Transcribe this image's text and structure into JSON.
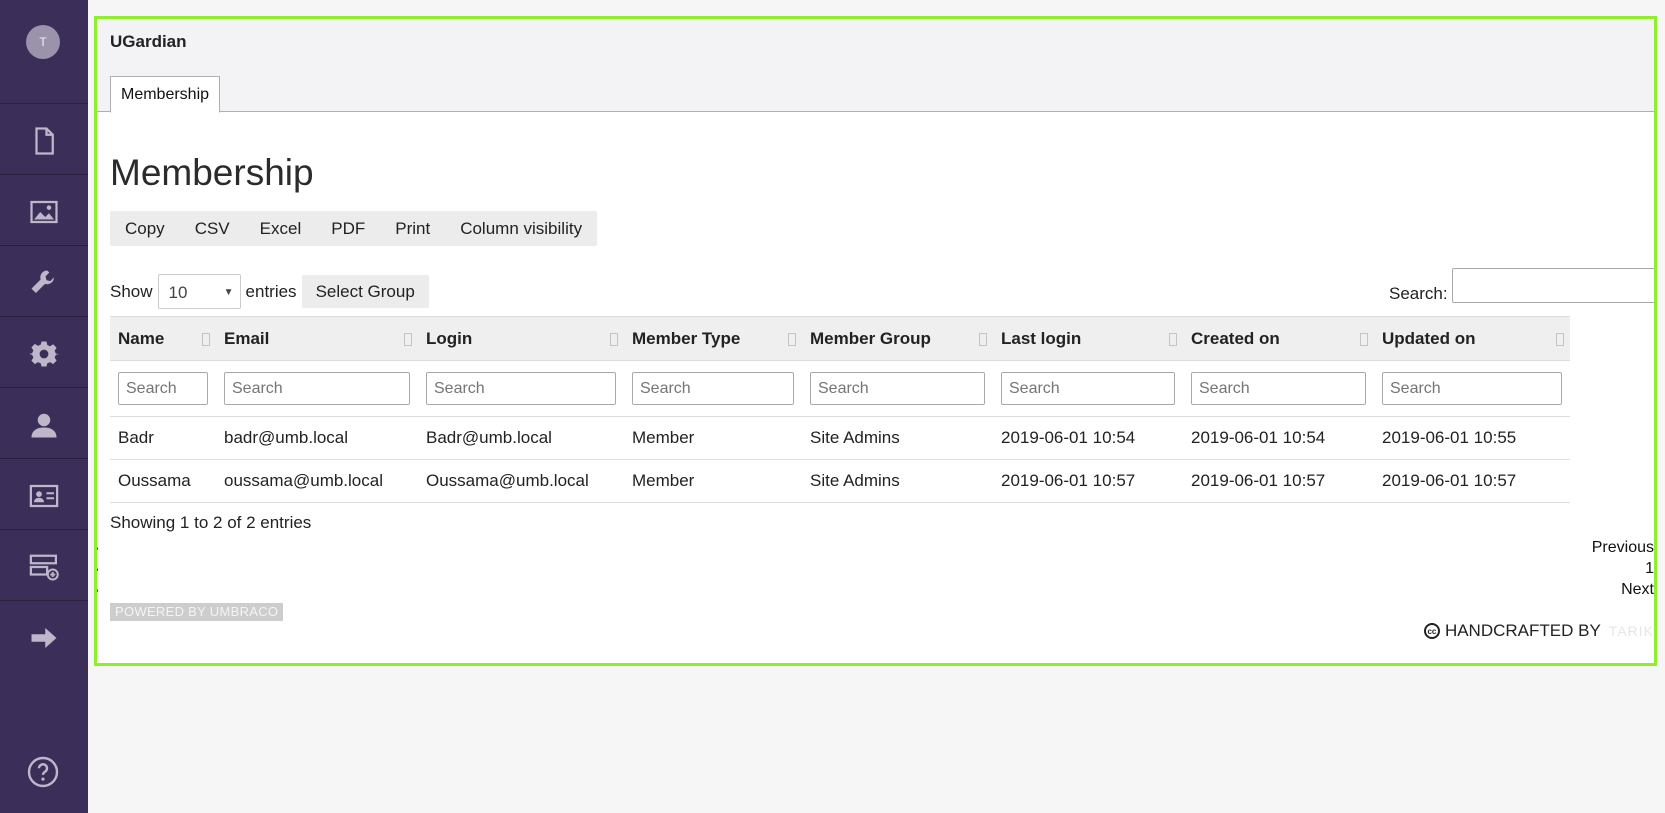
{
  "sidebar": {
    "avatar_initial": "T",
    "items": [
      {
        "name": "content",
        "icon": "document-icon"
      },
      {
        "name": "media",
        "icon": "image-icon"
      },
      {
        "name": "settings",
        "icon": "wrench-icon"
      },
      {
        "name": "developer",
        "icon": "gear-icon"
      },
      {
        "name": "users",
        "icon": "user-icon"
      },
      {
        "name": "members",
        "icon": "id-card-icon"
      },
      {
        "name": "forms",
        "icon": "server-add-icon"
      },
      {
        "name": "redirect",
        "icon": "arrow-right-icon"
      }
    ],
    "help_icon": "help-icon",
    "bg_color": "#3b2e58"
  },
  "header": {
    "app_title": "UGardian",
    "tab_label": "Membership"
  },
  "main": {
    "title": "Membership",
    "buttons": [
      "Copy",
      "CSV",
      "Excel",
      "PDF",
      "Print",
      "Column visibility"
    ],
    "length": {
      "show_label": "Show",
      "value": "10",
      "entries_label": "entries",
      "select_group": "Select Group"
    },
    "search_label": "Search:",
    "columns": [
      "Name",
      "Email",
      "Login",
      "Member Type",
      "Member Group",
      "Last login",
      "Created on",
      "Updated on"
    ],
    "filter_placeholder": "Search",
    "rows": [
      [
        "Badr",
        "badr@umb.local",
        "Badr@umb.local",
        "Member",
        "Site Admins",
        "2019-06-01 10:54",
        "2019-06-01 10:54",
        "2019-06-01 10:55"
      ],
      [
        "Oussama",
        "oussama@umb.local",
        "Oussama@umb.local",
        "Member",
        "Site Admins",
        "2019-06-01 10:57",
        "2019-06-01 10:57",
        "2019-06-01 10:57"
      ]
    ],
    "info": "Showing 1 to 2 of 2 entries",
    "pager": {
      "previous": "Previous",
      "page": "1",
      "next": "Next"
    }
  },
  "footer": {
    "powered": "POWERED BY UMBRACO",
    "cc": "cc",
    "handcrafted": "HANDCRAFTED BY",
    "author": "TARIK"
  },
  "colors": {
    "accent_frame": "#8fef2c"
  }
}
